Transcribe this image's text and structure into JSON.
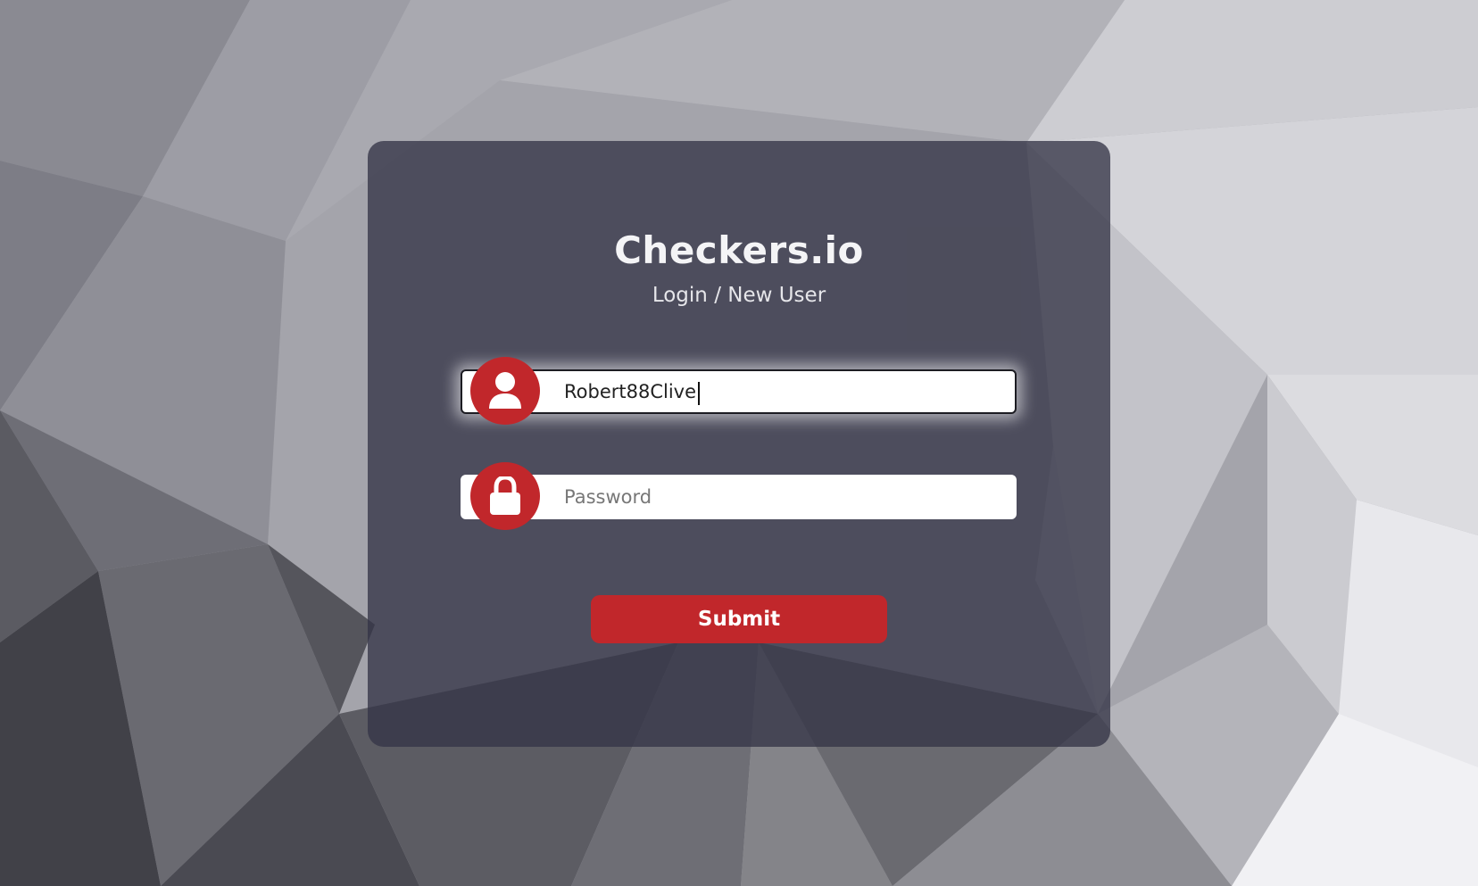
{
  "app": {
    "title": "Checkers.io",
    "subtitle": "Login / New User"
  },
  "form": {
    "username": {
      "value": "Robert88Clive",
      "placeholder": "",
      "icon": "user-icon"
    },
    "password": {
      "value": "",
      "placeholder": "Password",
      "icon": "lock-icon"
    },
    "submit_label": "Submit"
  },
  "colors": {
    "accent": "#c1272b",
    "card": "#3a3a4e",
    "text": "#f4f4f6"
  }
}
